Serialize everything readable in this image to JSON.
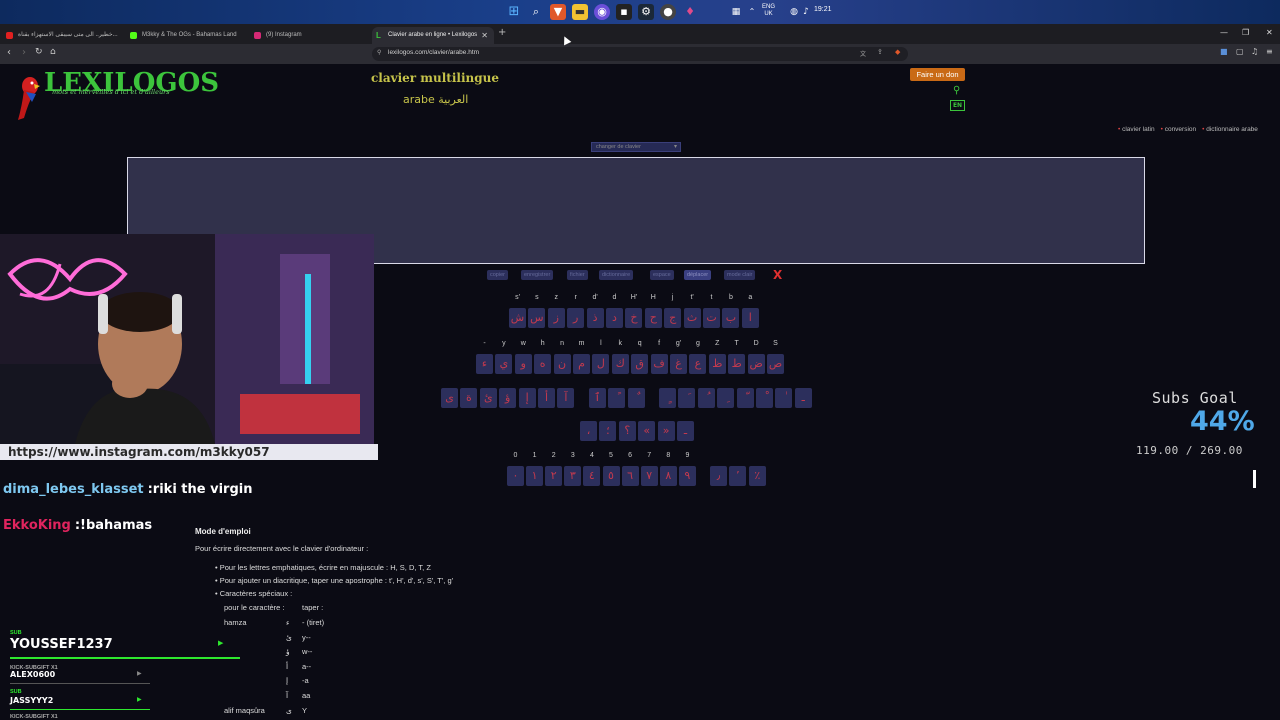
{
  "taskbar": {
    "clock": "19:21",
    "lang_top": "ENG",
    "lang_bottom": "UK"
  },
  "browser": {
    "tabs": [
      {
        "label": "خطير.. الى متى سيبقى الاستهزاء بقناة..."
      },
      {
        "label": "M3kky & The OGs - Bahamas Land"
      },
      {
        "label": "(9) Instagram"
      },
      {
        "label": "Clavier arabe en ligne • Lexilogos"
      }
    ],
    "url": "lexilogos.com/clavier/arabe.htm"
  },
  "page": {
    "logo": "LEXILOGOS",
    "logo_tagline": "mots et merveilles d'ici et d'ailleurs",
    "title": "clavier multilingue",
    "subtitle": "arabe  العربية",
    "donate": "Faire un don",
    "lang_switch": "EN",
    "top_links": [
      "clavier latin",
      "conversion",
      "dictionnaire arabe"
    ],
    "keyboard_select": "changer de clavier",
    "toolbar": [
      "copier",
      "enregistrer",
      "fichier",
      "dictionnaire",
      "espace",
      "déplacer",
      "mode clair"
    ],
    "clear": "X",
    "row1_latin": [
      "s'",
      "s",
      "z",
      "r",
      "d'",
      "d",
      "H'",
      "H",
      "j",
      "t'",
      "t",
      "b",
      "a"
    ],
    "row1_keys": [
      "ش",
      "س",
      "ز",
      "ر",
      "ذ",
      "د",
      "خ",
      "ح",
      "ج",
      "ث",
      "ت",
      "ب",
      "ا"
    ],
    "row2_latin": [
      "-",
      "y",
      "w",
      "h",
      "n",
      "m",
      "l",
      "k",
      "q",
      "f",
      "g'",
      "g",
      "Z",
      "T",
      "D",
      "S"
    ],
    "row2_keys": [
      "ء",
      "ي",
      "و",
      "ه",
      "ن",
      "م",
      "ل",
      "ك",
      "ق",
      "ف",
      "غ",
      "ع",
      "ظ",
      "ط",
      "ض",
      "ص"
    ],
    "row3_keys": [
      "ى",
      "ة",
      "ئ",
      "ؤ",
      "إ",
      "أ",
      "آ",
      "ٱ",
      "ً",
      "ٌ",
      "ٍ",
      "َ",
      "ُ",
      "ِ",
      "ّ",
      "ْ",
      "ٰ",
      "ـ"
    ],
    "row4_keys": [
      "،",
      "؛",
      "؟",
      "«",
      "»",
      "ـ"
    ],
    "row5_latin": [
      "0",
      "1",
      "2",
      "3",
      "4",
      "5",
      "6",
      "7",
      "8",
      "9"
    ],
    "row5_keys": [
      "٠",
      "١",
      "٢",
      "٣",
      "٤",
      "٥",
      "٦",
      "٧",
      "٨",
      "٩"
    ],
    "row5_extra": [
      "٫",
      "٬",
      "٪"
    ],
    "mode_emploi": "Mode d'emploi",
    "instr_intro": "Pour écrire directement avec le clavier d'ordinateur :",
    "instr_1": "Pour les lettres emphatiques, écrire en majuscule : H, S, D, T, Z",
    "instr_2": "Pour ajouter un diacritique, taper une apostrophe : t', H', d', s', S', T', g'",
    "instr_3": "Caractères spéciaux :",
    "table_head_char": "pour le caractère :",
    "table_head_type": "taper :",
    "table_rows": [
      {
        "name": "hamza",
        "ar": "ء",
        "type": "-  (tiret)"
      },
      {
        "name": "",
        "ar": "ئ",
        "type": "y--"
      },
      {
        "name": "",
        "ar": "ؤ",
        "type": "w--"
      },
      {
        "name": "",
        "ar": "أ",
        "type": "a--"
      },
      {
        "name": "",
        "ar": "إ",
        "type": "-a"
      },
      {
        "name": "",
        "ar": "آ",
        "type": "aa"
      },
      {
        "name": "alif maqsûra",
        "ar": "ى",
        "type": "Y"
      }
    ]
  },
  "stream": {
    "instagram": "https://www.instagram.com/m3kky057",
    "chat": [
      {
        "user": "dima_lebes_klasset",
        "msg": ":riki the virgin",
        "color": "#7ec8f0"
      },
      {
        "user": "EkkoKing",
        "msg": ":!bahamas",
        "color": "#e0245e"
      }
    ],
    "alerts": [
      {
        "type": "SUB",
        "name": "YOUSSEF1237"
      },
      {
        "type": "KICK-SUBGIFT X1",
        "name": "ALEX0600"
      },
      {
        "type": "SUB",
        "name": "JASSYYY2"
      },
      {
        "type": "KICK-SUBGIFT X1",
        "name": ""
      }
    ],
    "subs_goal": {
      "title": "Subs Goal",
      "percent": "44%",
      "count": "119.00 / 269.00",
      "progress": 0.44
    }
  },
  "colors": {
    "accent_green": "#3cc43c",
    "key_red": "#c23a4e",
    "key_bg": "#2c2f5c",
    "goal_blue": "#4fa8e8"
  }
}
